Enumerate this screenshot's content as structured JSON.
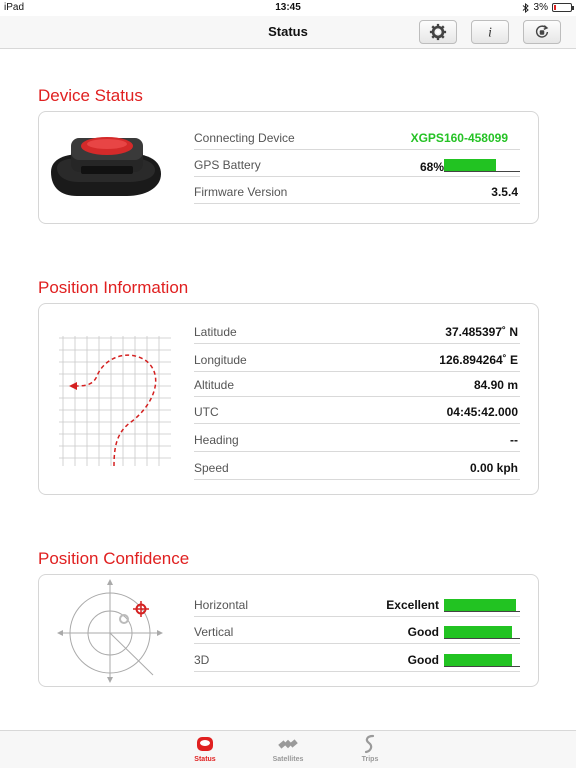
{
  "statusbar": {
    "device": "iPad",
    "time": "13:45",
    "battery": "3%"
  },
  "navbar": {
    "title": "Status",
    "buttons": [
      "gear-icon",
      "info-icon",
      "reset-icon"
    ]
  },
  "device_status": {
    "title": "Device Status",
    "rows": [
      {
        "label": "Connecting Device",
        "value": "XGPS160-458099"
      },
      {
        "label": "GPS Battery",
        "value": "68%",
        "level": 0.68
      },
      {
        "label": "Firmware Version",
        "value": "3.5.4"
      }
    ]
  },
  "position_info": {
    "title": "Position Information",
    "rows": [
      {
        "label": "Latitude",
        "value": "37.485397˚ N"
      },
      {
        "label": "Longitude",
        "value": "126.894264˚ E"
      },
      {
        "label": "Altitude",
        "value": "84.90 m"
      },
      {
        "label": "UTC",
        "value": "04:45:42.000"
      },
      {
        "label": "Heading",
        "value": "--"
      },
      {
        "label": "Speed",
        "value": "0.00 kph"
      }
    ]
  },
  "position_confidence": {
    "title": "Position Confidence",
    "rows": [
      {
        "label": "Horizontal",
        "value": "Excellent",
        "level": 0.95
      },
      {
        "label": "Vertical",
        "value": "Good",
        "level": 0.9
      },
      {
        "label": "3D",
        "value": "Good",
        "level": 0.9
      }
    ]
  },
  "tabs": [
    {
      "label": "Status",
      "active": true
    },
    {
      "label": "Satellites",
      "active": false
    },
    {
      "label": "Trips",
      "active": false
    }
  ],
  "colors": {
    "accent": "#e02020",
    "good": "#22c322",
    "device_name": "#25c225"
  }
}
